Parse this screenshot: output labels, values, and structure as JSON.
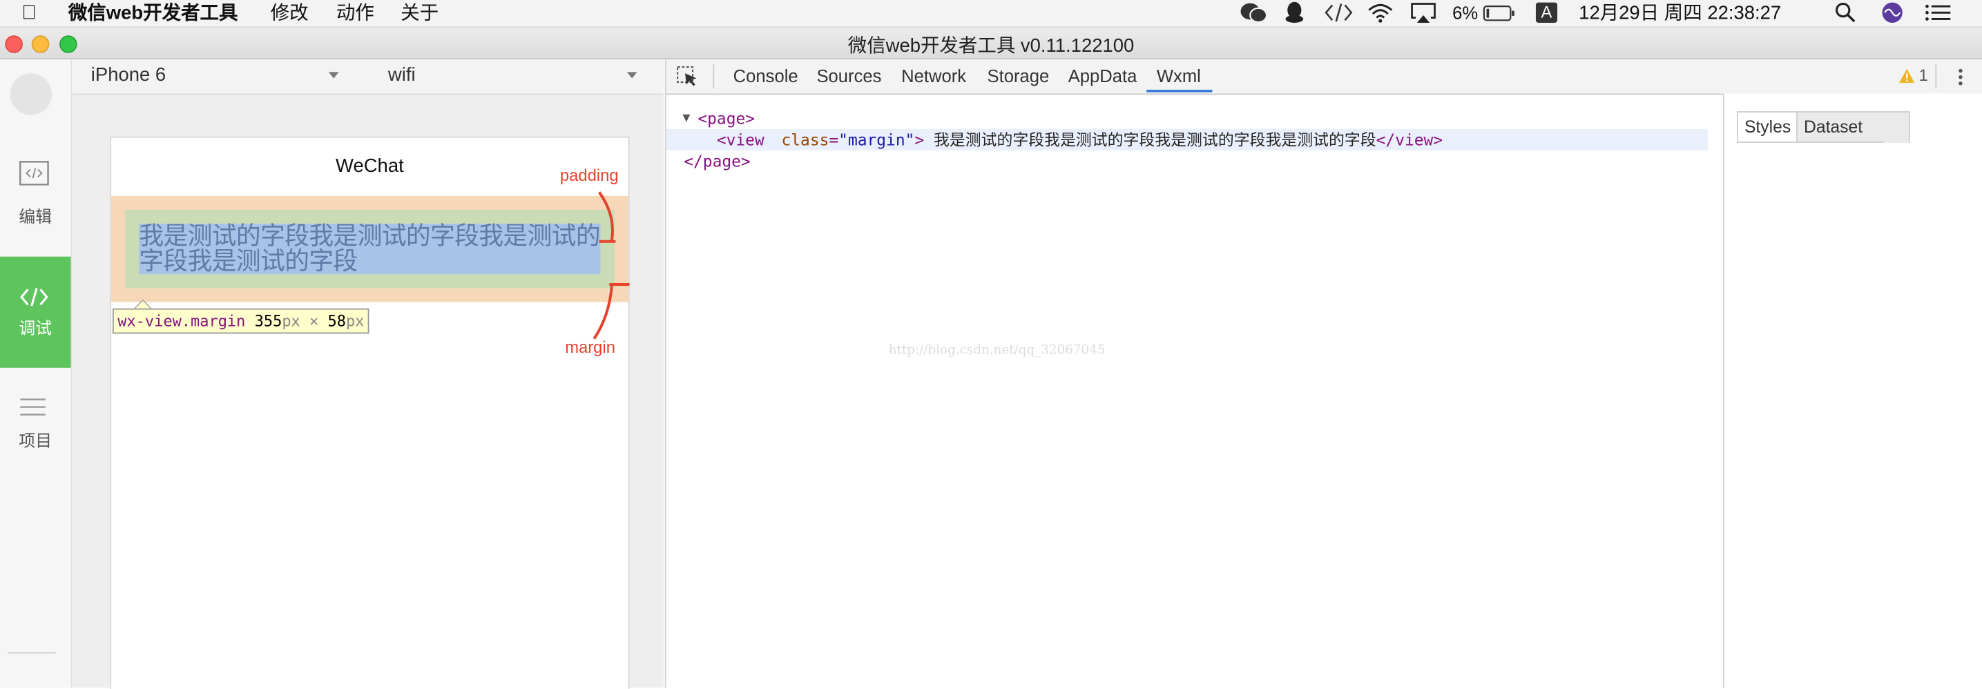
{
  "menubar": {
    "app_name": "微信web开发者工具",
    "menus": [
      "修改",
      "动作",
      "关于"
    ],
    "battery": "6%",
    "input_method": "A",
    "datetime": "12月29日 周四  22:38:27",
    "status_icons": [
      "wechat-icon",
      "qq-icon",
      "code-icon",
      "wifi-icon",
      "airplay-icon",
      "battery-icon",
      "search-icon",
      "siri-icon",
      "menu-list-icon"
    ]
  },
  "window": {
    "title": "微信web开发者工具 v0.11.122100"
  },
  "sidebar": {
    "items": [
      {
        "label": "编辑",
        "icon": "code-window-icon"
      },
      {
        "label": "调试",
        "icon": "code-icon",
        "active": true
      },
      {
        "label": "项目",
        "icon": "list-icon"
      }
    ]
  },
  "simulator": {
    "device": "iPhone 6",
    "network": "wifi",
    "nav_title": "WeChat",
    "content_text": "我是测试的字段我是测试的字段我是测试的字段我是测试的字段",
    "inspect_tooltip": {
      "selector": "wx-view.margin",
      "width": "355",
      "height": "58",
      "unit": "px",
      "times": "×"
    },
    "annotations": {
      "padding": "padding",
      "margin": "margin"
    }
  },
  "devtools": {
    "tabs": [
      "Console",
      "Sources",
      "Network",
      "Storage",
      "AppData",
      "Wxml"
    ],
    "active_tab": "Wxml",
    "warning_count": "1",
    "wxml": {
      "page_open": "<page>",
      "view_open": "<view",
      "attr_name": "class",
      "attr_value": "\"margin\"",
      "view_text": "我是测试的字段我是测试的字段我是测试的字段我是测试的字段",
      "view_close": "</view>",
      "page_close": "</page>"
    },
    "watermark": "http://blog.csdn.net/qq_32067045",
    "side_tabs": [
      "Styles",
      "Dataset"
    ]
  },
  "colors": {
    "accent_green": "#5ec55e",
    "tab_underline": "#3879d9",
    "margin_overlay": "#f6d8b8",
    "padding_overlay": "#c9dcb6",
    "content_overlay": "#a9c2e8",
    "annotation": "#e4432d"
  }
}
